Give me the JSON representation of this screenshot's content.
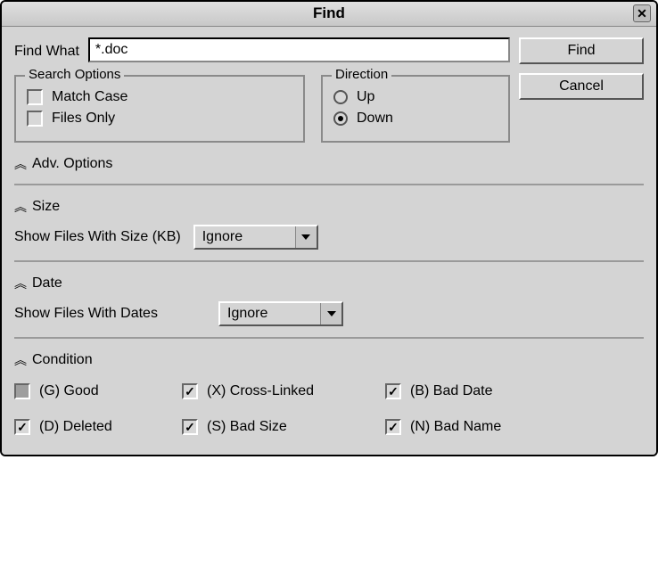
{
  "window": {
    "title": "Find",
    "close_icon": "✕"
  },
  "find_what": {
    "label": "Find What",
    "value": "*.doc"
  },
  "buttons": {
    "find": "Find",
    "cancel": "Cancel"
  },
  "search_options": {
    "legend": "Search Options",
    "match_case": {
      "label": "Match Case",
      "checked": false
    },
    "files_only": {
      "label": "Files Only",
      "checked": false
    }
  },
  "direction": {
    "legend": "Direction",
    "up": {
      "label": "Up",
      "selected": false
    },
    "down": {
      "label": "Down",
      "selected": true
    }
  },
  "adv_options": {
    "label": "Adv. Options"
  },
  "size_section": {
    "heading": "Size",
    "label": "Show Files With Size (KB)",
    "selected": "Ignore"
  },
  "date_section": {
    "heading": "Date",
    "label": "Show Files With Dates",
    "selected": "Ignore"
  },
  "condition_section": {
    "heading": "Condition",
    "items": [
      {
        "label": "(G) Good",
        "checked": "indeterminate"
      },
      {
        "label": "(X) Cross-Linked",
        "checked": true
      },
      {
        "label": "(B) Bad Date",
        "checked": true
      },
      {
        "label": "(D) Deleted",
        "checked": true
      },
      {
        "label": "(S) Bad Size",
        "checked": true
      },
      {
        "label": "(N) Bad Name",
        "checked": true
      }
    ]
  }
}
